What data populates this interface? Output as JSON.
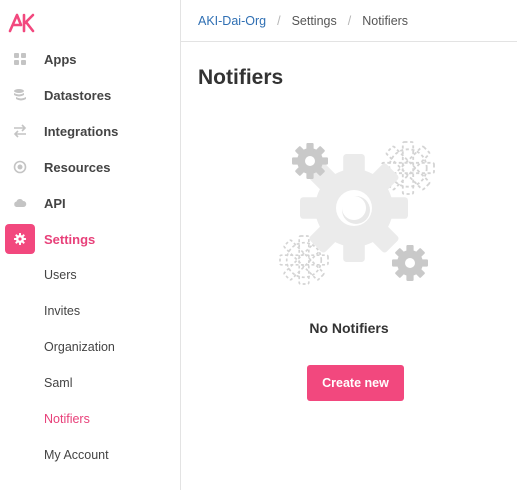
{
  "logo": {
    "text": "AK",
    "icon": "ak-logo-icon",
    "color": "#f2487e"
  },
  "sidebar": {
    "items": [
      {
        "label": "Apps",
        "icon": "grid-icon"
      },
      {
        "label": "Datastores",
        "icon": "database-icon"
      },
      {
        "label": "Integrations",
        "icon": "swap-arrows-icon"
      },
      {
        "label": "Resources",
        "icon": "target-icon"
      },
      {
        "label": "API",
        "icon": "cloud-icon"
      },
      {
        "label": "Settings",
        "icon": "gear-icon",
        "active": true
      }
    ],
    "sub_items": [
      {
        "label": "Users"
      },
      {
        "label": "Invites"
      },
      {
        "label": "Organization"
      },
      {
        "label": "Saml"
      },
      {
        "label": "Notifiers",
        "active": true
      },
      {
        "label": "My Account"
      }
    ]
  },
  "breadcrumb": {
    "org": "AKI-Dai-Org",
    "section": "Settings",
    "page": "Notifiers",
    "separator": "/"
  },
  "main": {
    "title": "Notifiers",
    "empty_title": "No Notifiers",
    "create_button": "Create new",
    "illustration_icon": "gears-icon"
  },
  "colors": {
    "accent": "#f2487e",
    "link": "#2f6fb3",
    "icon_gray": "#c4c4c4"
  }
}
